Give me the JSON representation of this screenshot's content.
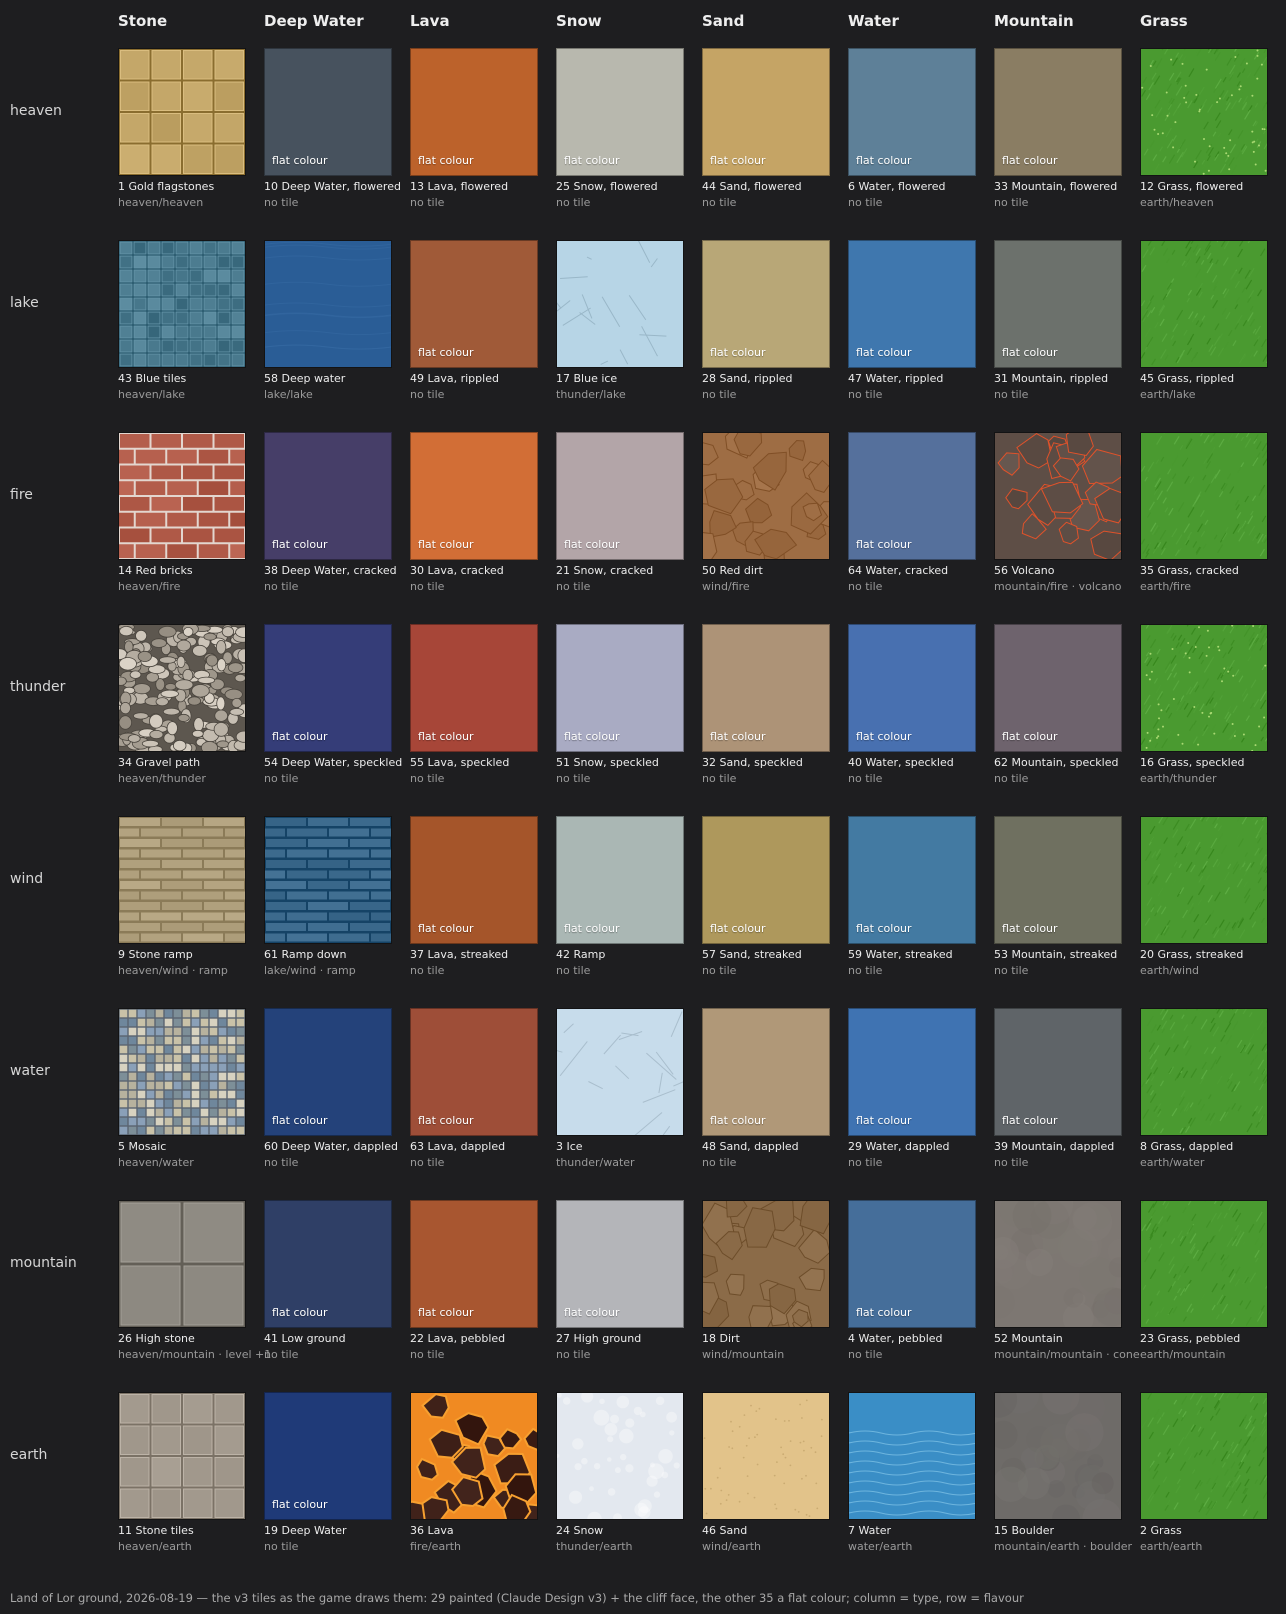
{
  "columns": [
    "Stone",
    "Deep Water",
    "Lava",
    "Snow",
    "Sand",
    "Water",
    "Mountain",
    "Grass"
  ],
  "rows": [
    "heaven",
    "lake",
    "fire",
    "thunder",
    "wind",
    "water",
    "mountain",
    "earth"
  ],
  "flat_label": "flat colour",
  "cells": [
    [
      {
        "title": "1  Gold flagstones",
        "sub": "heaven/heaven",
        "flat": false,
        "color": "#c1a466",
        "pattern": "flagstones"
      },
      {
        "title": "10  Deep Water, flowered",
        "sub": "no tile",
        "flat": true,
        "color": "#47525e"
      },
      {
        "title": "13  Lava, flowered",
        "sub": "no tile",
        "flat": true,
        "color": "#bc622b"
      },
      {
        "title": "25  Snow, flowered",
        "sub": "no tile",
        "flat": true,
        "color": "#b8b8ae"
      },
      {
        "title": "44  Sand, flowered",
        "sub": "no tile",
        "flat": true,
        "color": "#c5a465"
      },
      {
        "title": "6  Water, flowered",
        "sub": "no tile",
        "flat": true,
        "color": "#5e8098"
      },
      {
        "title": "33  Mountain, flowered",
        "sub": "no tile",
        "flat": true,
        "color": "#8a7d63"
      },
      {
        "title": "12  Grass, flowered",
        "sub": "earth/heaven",
        "flat": false,
        "color": "#4a9a30",
        "pattern": "grass-flowered"
      }
    ],
    [
      {
        "title": "43  Blue tiles",
        "sub": "heaven/lake",
        "flat": false,
        "color": "#4a7a8e",
        "pattern": "bluetiles"
      },
      {
        "title": "58  Deep water",
        "sub": "lake/lake",
        "flat": false,
        "color": "#2a5d96",
        "pattern": "deepwater"
      },
      {
        "title": "49  Lava, rippled",
        "sub": "no tile",
        "flat": true,
        "color": "#a05a38"
      },
      {
        "title": "17  Blue ice",
        "sub": "thunder/lake",
        "flat": false,
        "color": "#b7d5e6",
        "pattern": "ice"
      },
      {
        "title": "28  Sand, rippled",
        "sub": "no tile",
        "flat": true,
        "color": "#b8a777"
      },
      {
        "title": "47  Water, rippled",
        "sub": "no tile",
        "flat": true,
        "color": "#3f77ae"
      },
      {
        "title": "31  Mountain, rippled",
        "sub": "no tile",
        "flat": true,
        "color": "#6c716c"
      },
      {
        "title": "45  Grass, rippled",
        "sub": "earth/lake",
        "flat": false,
        "color": "#4a9a30",
        "pattern": "grass"
      }
    ],
    [
      {
        "title": "14  Red bricks",
        "sub": "heaven/fire",
        "flat": false,
        "color": "#b05a48",
        "pattern": "bricks"
      },
      {
        "title": "38  Deep Water, cracked",
        "sub": "no tile",
        "flat": true,
        "color": "#463e68"
      },
      {
        "title": "30  Lava, cracked",
        "sub": "no tile",
        "flat": true,
        "color": "#d26e36"
      },
      {
        "title": "21  Snow, cracked",
        "sub": "no tile",
        "flat": true,
        "color": "#b3a5a8"
      },
      {
        "title": "50  Red dirt",
        "sub": "wind/fire",
        "flat": false,
        "color": "#9e6d44",
        "pattern": "dirt"
      },
      {
        "title": "64  Water, cracked",
        "sub": "no tile",
        "flat": true,
        "color": "#55709c"
      },
      {
        "title": "56  Volcano",
        "sub": "mountain/fire · volcano",
        "flat": false,
        "color": "#5e4e46",
        "pattern": "volcano"
      },
      {
        "title": "35  Grass, cracked",
        "sub": "earth/fire",
        "flat": false,
        "color": "#4a9a30",
        "pattern": "grass"
      }
    ],
    [
      {
        "title": "34  Gravel path",
        "sub": "heaven/thunder",
        "flat": false,
        "color": "#9a9182",
        "pattern": "gravel"
      },
      {
        "title": "54  Deep Water, speckled",
        "sub": "no tile",
        "flat": true,
        "color": "#353d78"
      },
      {
        "title": "55  Lava, speckled",
        "sub": "no tile",
        "flat": true,
        "color": "#a74638"
      },
      {
        "title": "51  Snow, speckled",
        "sub": "no tile",
        "flat": true,
        "color": "#a9abc3"
      },
      {
        "title": "32  Sand, speckled",
        "sub": "no tile",
        "flat": true,
        "color": "#ad9377"
      },
      {
        "title": "40  Water, speckled",
        "sub": "no tile",
        "flat": true,
        "color": "#4870b0"
      },
      {
        "title": "62  Mountain, speckled",
        "sub": "no tile",
        "flat": true,
        "color": "#6e636d"
      },
      {
        "title": "16  Grass, speckled",
        "sub": "earth/thunder",
        "flat": false,
        "color": "#4a9a30",
        "pattern": "grass-flowered"
      }
    ],
    [
      {
        "title": "9  Stone ramp",
        "sub": "heaven/wind · ramp",
        "flat": false,
        "color": "#b3a380",
        "pattern": "ramp"
      },
      {
        "title": "61  Ramp down",
        "sub": "lake/wind · ramp",
        "flat": false,
        "color": "#3d6b8e",
        "pattern": "ramp-blue"
      },
      {
        "title": "37  Lava, streaked",
        "sub": "no tile",
        "flat": true,
        "color": "#a5552a"
      },
      {
        "title": "42  Ramp",
        "sub": "no tile",
        "flat": true,
        "color": "#aab7b4"
      },
      {
        "title": "57  Sand, streaked",
        "sub": "no tile",
        "flat": true,
        "color": "#ae985c"
      },
      {
        "title": "59  Water, streaked",
        "sub": "no tile",
        "flat": true,
        "color": "#437aa2"
      },
      {
        "title": "53  Mountain, streaked",
        "sub": "no tile",
        "flat": true,
        "color": "#6f7060"
      },
      {
        "title": "20  Grass, streaked",
        "sub": "earth/wind",
        "flat": false,
        "color": "#4a9a30",
        "pattern": "grass"
      }
    ],
    [
      {
        "title": "5  Mosaic",
        "sub": "heaven/water",
        "flat": false,
        "color": "#8a98a0",
        "pattern": "mosaic"
      },
      {
        "title": "60  Deep Water, dappled",
        "sub": "no tile",
        "flat": true,
        "color": "#24427a"
      },
      {
        "title": "63  Lava, dappled",
        "sub": "no tile",
        "flat": true,
        "color": "#9e4e38"
      },
      {
        "title": "3  Ice",
        "sub": "thunder/water",
        "flat": false,
        "color": "#c7dceb",
        "pattern": "ice"
      },
      {
        "title": "48  Sand, dappled",
        "sub": "no tile",
        "flat": true,
        "color": "#b09878"
      },
      {
        "title": "29  Water, dappled",
        "sub": "no tile",
        "flat": true,
        "color": "#3f73b2"
      },
      {
        "title": "39  Mountain, dappled",
        "sub": "no tile",
        "flat": true,
        "color": "#5f6468"
      },
      {
        "title": "8  Grass, dappled",
        "sub": "earth/water",
        "flat": false,
        "color": "#4a9a30",
        "pattern": "grass"
      }
    ],
    [
      {
        "title": "26  High stone",
        "sub": "heaven/mountain · level +1",
        "flat": false,
        "color": "#8b877f",
        "pattern": "bigslabs"
      },
      {
        "title": "41  Low ground",
        "sub": "no tile",
        "flat": true,
        "color": "#2f3f66"
      },
      {
        "title": "22  Lava, pebbled",
        "sub": "no tile",
        "flat": true,
        "color": "#a85630"
      },
      {
        "title": "27  High ground",
        "sub": "no tile",
        "flat": true,
        "color": "#b4b5b9"
      },
      {
        "title": "18  Dirt",
        "sub": "wind/mountain",
        "flat": false,
        "color": "#8b6b48",
        "pattern": "dirt"
      },
      {
        "title": "4  Water, pebbled",
        "sub": "no tile",
        "flat": true,
        "color": "#456e9a"
      },
      {
        "title": "52  Mountain",
        "sub": "mountain/mountain · cone",
        "flat": false,
        "color": "#7d7772",
        "pattern": "rock"
      },
      {
        "title": "23  Grass, pebbled",
        "sub": "earth/mountain",
        "flat": false,
        "color": "#4a9a30",
        "pattern": "grass"
      }
    ],
    [
      {
        "title": "11  Stone tiles",
        "sub": "heaven/earth",
        "flat": false,
        "color": "#a39a8e",
        "pattern": "stonetiles"
      },
      {
        "title": "19  Deep Water",
        "sub": "no tile",
        "flat": true,
        "color": "#1f3a78"
      },
      {
        "title": "36  Lava",
        "sub": "fire/earth",
        "flat": false,
        "color": "#3a1c14",
        "pattern": "lava"
      },
      {
        "title": "24  Snow",
        "sub": "thunder/earth",
        "flat": false,
        "color": "#e3e8ef",
        "pattern": "snow"
      },
      {
        "title": "46  Sand",
        "sub": "wind/earth",
        "flat": false,
        "color": "#e2c38a",
        "pattern": "sand"
      },
      {
        "title": "7  Water",
        "sub": "water/earth",
        "flat": false,
        "color": "#3a8ec6",
        "pattern": "water"
      },
      {
        "title": "15  Boulder",
        "sub": "mountain/earth · boulder",
        "flat": false,
        "color": "#6e6b68",
        "pattern": "rock-dark"
      },
      {
        "title": "2  Grass",
        "sub": "earth/earth",
        "flat": false,
        "color": "#4a9a30",
        "pattern": "grass"
      }
    ]
  ],
  "footer": "Land of Lor ground, 2026-08-19 — the v3 tiles as the game draws them: 29 painted (Claude Design v3) + the cliff face, the other 35 a flat colour; column = type, row = flavour"
}
